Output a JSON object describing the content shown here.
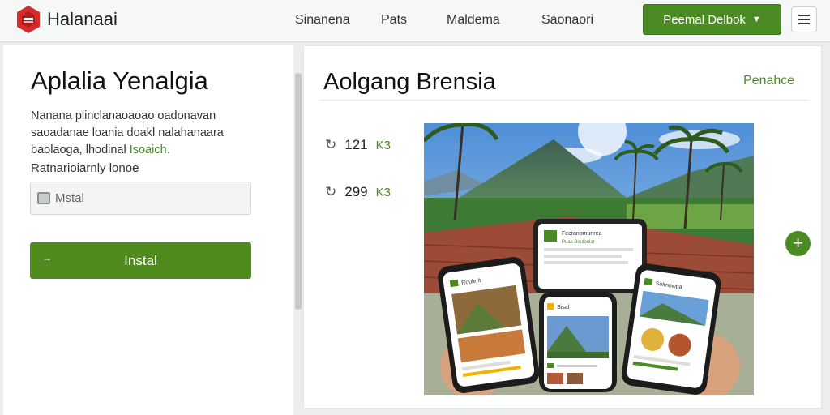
{
  "brand": {
    "name": "Halanaai"
  },
  "nav": {
    "links": [
      "Sinanena",
      "Pats",
      "Maldema",
      "Saonaori"
    ],
    "cta_label": "Peemal Delbok",
    "menu_icon": "hamburger-icon"
  },
  "left": {
    "title": "Aplalia Yenalgia",
    "desc_lines": [
      "Nanana plinclanaoaoao oadonavan",
      "saoadanae loania doakl nalahanaara",
      "baolaoga, lhodinal"
    ],
    "desc_highlight": "Isoaich.",
    "field_label": "Ratnarioiarnly lonoe",
    "field_placeholder": "Mstal",
    "install_label": "Instal",
    "install_prefix": "→"
  },
  "card": {
    "title": "Aolgang Brensia",
    "link": "Penahce",
    "stats": [
      {
        "icon": "share-icon",
        "value": "121",
        "badge": "K3"
      },
      {
        "icon": "share-icon",
        "value": "299",
        "badge": "K3"
      }
    ],
    "phones": {
      "left": {
        "header": "Roulerit"
      },
      "middle": {
        "header": "Sisal"
      },
      "tablet": {
        "title": "Fecranomunrea",
        "subtitle": "Puas Beulonlar"
      },
      "right": {
        "header": "Solrnowpa"
      }
    },
    "add_icon": "plus-icon"
  }
}
